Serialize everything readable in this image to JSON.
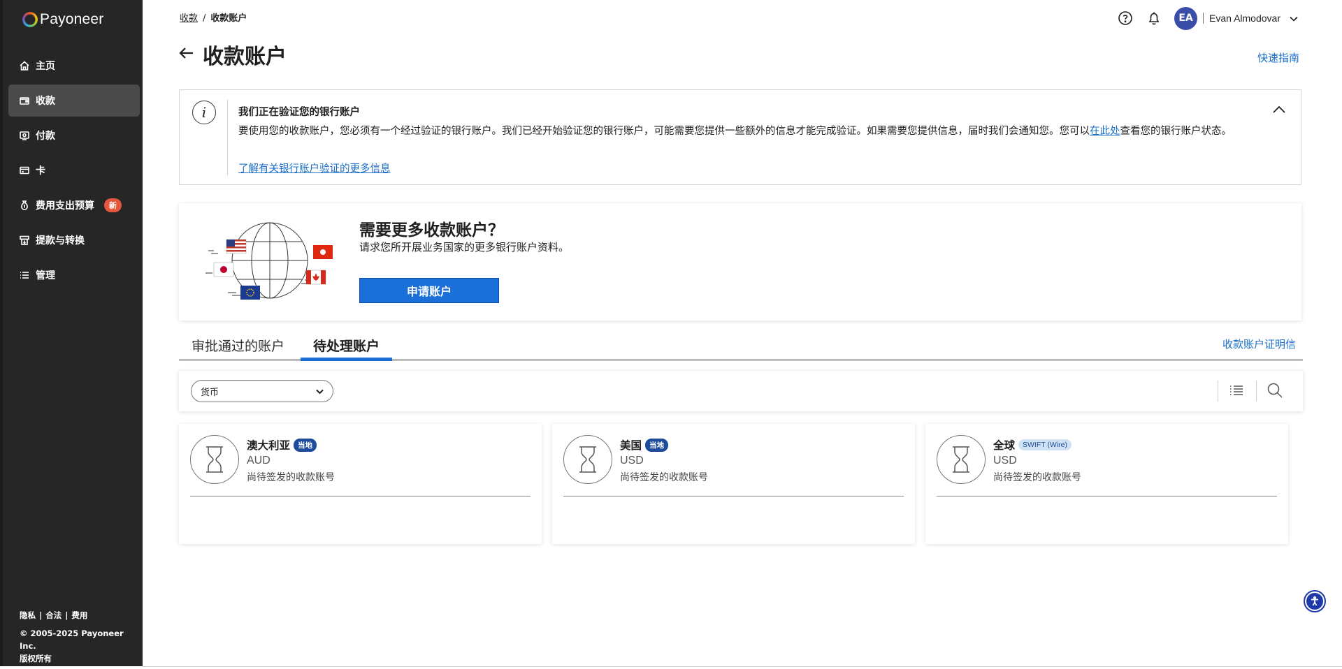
{
  "brand": {
    "name": "Payoneer"
  },
  "sidebar": {
    "items": [
      {
        "label": "主页",
        "icon": "home-icon"
      },
      {
        "label": "收款",
        "icon": "wallet-icon",
        "active": true
      },
      {
        "label": "付款",
        "icon": "payment-icon"
      },
      {
        "label": "卡",
        "icon": "card-icon"
      },
      {
        "label": "费用支出预算",
        "icon": "money-bag-icon",
        "badge": "新"
      },
      {
        "label": "提款与转换",
        "icon": "withdraw-icon"
      },
      {
        "label": "管理",
        "icon": "list-icon"
      }
    ],
    "footer": {
      "privacy": "隐私",
      "legal": "合法",
      "fees": "费用",
      "sep": "|",
      "copyright": "© 2005-2025 Payoneer Inc.",
      "rights": "版权所有"
    }
  },
  "header": {
    "breadcrumb": {
      "parent": "收款",
      "sep": "/",
      "current": "收款账户"
    },
    "user": {
      "initials": "EA",
      "name": "Evan Almodovar"
    }
  },
  "page": {
    "title": "收款账户",
    "quick_guide": "快速指南"
  },
  "banner": {
    "icon_glyph": "i",
    "title": "我们正在验证您的银行账户",
    "body_before": "要使用您的收款账户，您必须有一个经过验证的银行账户。我们已经开始验证您的银行账户，可能需要您提供一些额外的信息才能完成验证。如果需要您提供信息，届时我们会通知您。您可以",
    "body_link": "在此处",
    "body_after": "查看您的银行账户状态。",
    "more_link": "了解有关银行账户验证的更多信息"
  },
  "promo": {
    "title": "需要更多收款账户？",
    "subtitle": "请求您所开展业务国家的更多银行账户资料。",
    "button": "申请账户"
  },
  "tabs": {
    "approved": "审批通过的账户",
    "pending": "待处理账户",
    "certificate_link": "收款账户证明信"
  },
  "filter": {
    "currency_label": "货币"
  },
  "accounts": [
    {
      "name": "澳大利亚",
      "badge": "当地",
      "badge_type": "local",
      "currency": "AUD",
      "status": "尚待签发的收款账号"
    },
    {
      "name": "美国",
      "badge": "当地",
      "badge_type": "local",
      "currency": "USD",
      "status": "尚待签发的收款账号"
    },
    {
      "name": "全球",
      "badge": "SWIFT (Wire)",
      "badge_type": "swift",
      "currency": "USD",
      "status": "尚待签发的收款账号"
    }
  ],
  "colors": {
    "sidebar_bg": "#262626",
    "accent_blue": "#1a6fd9",
    "link_blue": "#1a6fc9",
    "badge_new": "#e8553d",
    "badge_local": "#1d4c9c",
    "avatar": "#3a4da8"
  }
}
